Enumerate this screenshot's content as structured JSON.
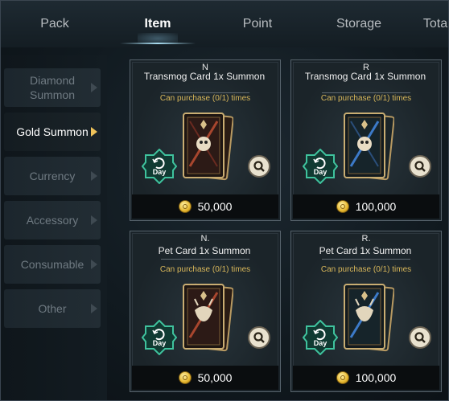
{
  "tabs": [
    {
      "label": "Pack"
    },
    {
      "label": "Item"
    },
    {
      "label": "Point"
    },
    {
      "label": "Storage"
    },
    {
      "label": "Tota"
    }
  ],
  "active_tab": "Item",
  "sidebar": {
    "items": [
      {
        "label": "Diamond Summon"
      },
      {
        "label": "Gold Summon"
      },
      {
        "label": "Currency"
      },
      {
        "label": "Accessory"
      },
      {
        "label": "Consumable"
      },
      {
        "label": "Other"
      }
    ],
    "active": "Gold Summon"
  },
  "cards": [
    {
      "grade": "N",
      "title": "Transmog Card 1x Summon",
      "purchase": "Can purchase (0/1) times",
      "badge": "Day",
      "price": "50,000",
      "art": "transmog-n"
    },
    {
      "grade": "R",
      "title": "Transmog Card 1x Summon",
      "purchase": "Can purchase (0/1) times",
      "badge": "Day",
      "price": "100,000",
      "art": "transmog-r"
    },
    {
      "grade": "N.",
      "title": "Pet Card 1x Summon",
      "purchase": "Can purchase (0/1) times",
      "badge": "Day",
      "price": "50,000",
      "art": "pet-n"
    },
    {
      "grade": "R.",
      "title": "Pet Card 1x Summon",
      "purchase": "Can purchase (0/1) times",
      "badge": "Day",
      "price": "100,000",
      "art": "pet-r"
    }
  ],
  "colors": {
    "gold_text": "#d8b75a",
    "badge_green": "#2f9a7c",
    "active_arrow": "#f0c35a"
  },
  "icons": {
    "refresh": "refresh-icon",
    "magnify": "magnifier-icon",
    "coin": "gold-coin-icon"
  }
}
